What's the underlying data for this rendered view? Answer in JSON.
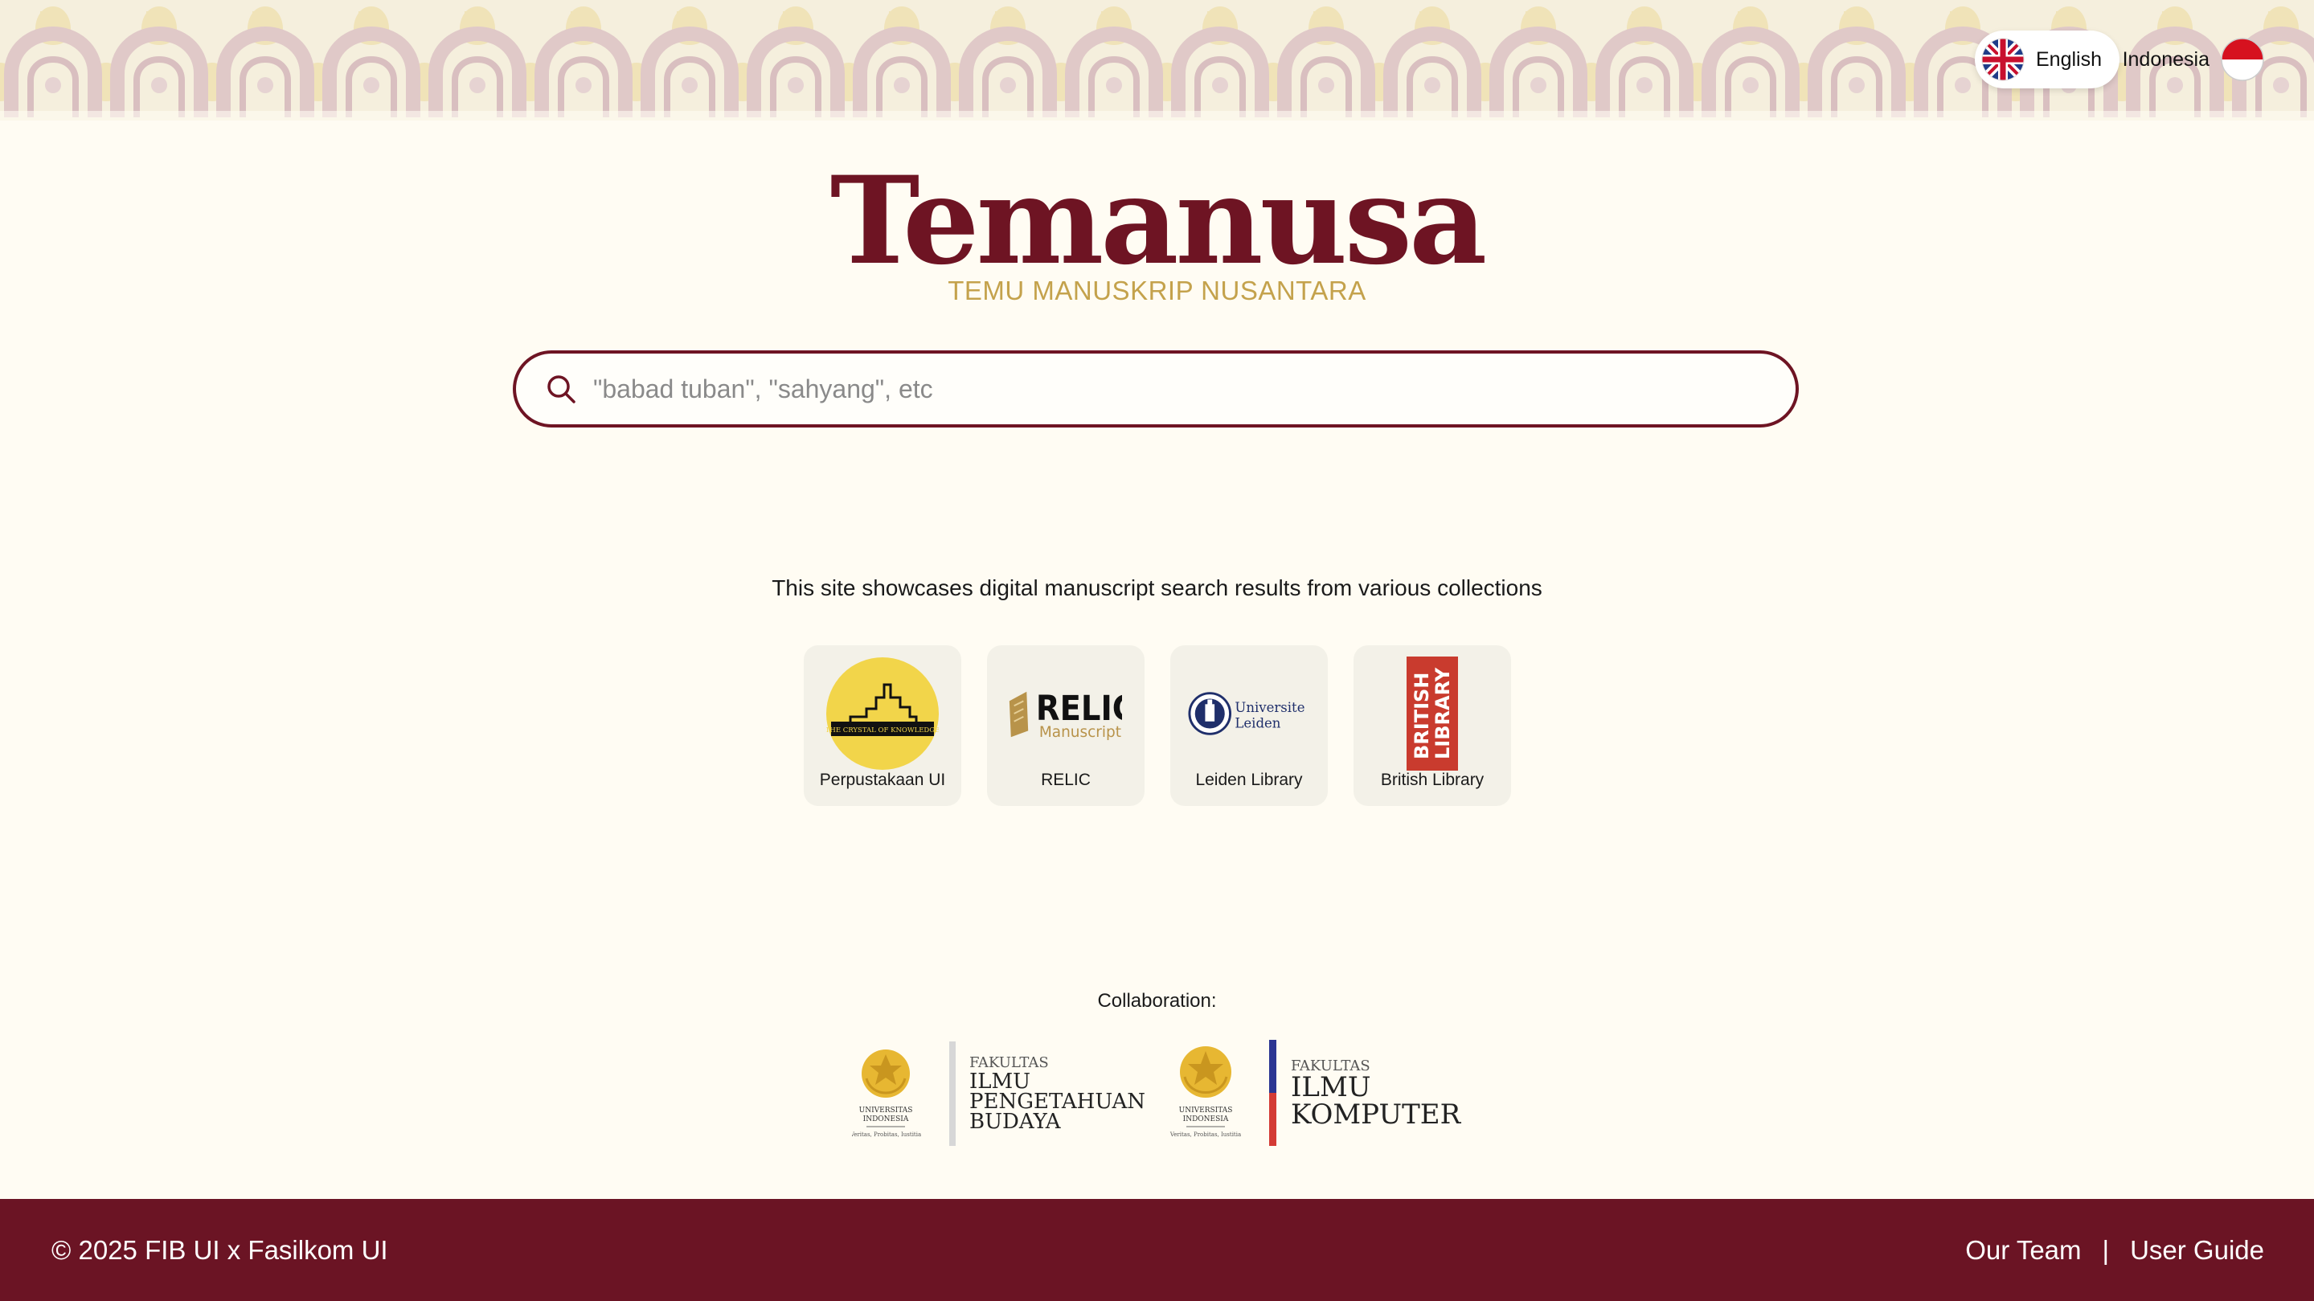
{
  "language": {
    "english_label": "English",
    "indonesia_label": "Indonesia",
    "active": "English"
  },
  "brand": {
    "title": "Temanusa",
    "tagline": "TEMU MANUSKRIP NUSANTARA"
  },
  "search": {
    "placeholder": "\"babad tuban\", \"sahyang\", etc",
    "value": ""
  },
  "showcase_text": "This site showcases digital manuscript search results from various collections",
  "collections": [
    {
      "label": "Perpustakaan UI",
      "logo_text": "THE CRYSTAL OF KNOWLEDGE"
    },
    {
      "label": "RELIC",
      "logo_title": "RELIC",
      "logo_sub": "Manuscript"
    },
    {
      "label": "Leiden Library",
      "logo_line1": "Universiteit",
      "logo_line2": "Leiden"
    },
    {
      "label": "British Library",
      "logo_line1": "BRITISH",
      "logo_line2": "LIBRARY"
    }
  ],
  "collaboration": {
    "label": "Collaboration:",
    "partners": [
      {
        "seal_line1": "UNIVERSITAS",
        "seal_line2": "INDONESIA",
        "seal_motto": "Veritas, Probitas, Iustitia",
        "kicker": "FAKULTAS",
        "lines": [
          "ILMU",
          "PENGETAHUAN",
          "BUDAYA"
        ]
      },
      {
        "seal_line1": "UNIVERSITAS",
        "seal_line2": "INDONESIA",
        "seal_motto": "Veritas, Probitas, Iustitia",
        "kicker": "FAKULTAS",
        "lines": [
          "ILMU",
          "KOMPUTER"
        ]
      }
    ]
  },
  "footer": {
    "copyright": "© 2025 FIB UI x Fasilkom UI",
    "links": [
      "Our Team",
      "User Guide"
    ],
    "separator": "|"
  },
  "colors": {
    "primary": "#6E1423",
    "footer_bg": "#6B1424",
    "gold": "#C4A24C",
    "page_bg": "#FFFCF3",
    "card_bg": "#F3F1E8"
  }
}
